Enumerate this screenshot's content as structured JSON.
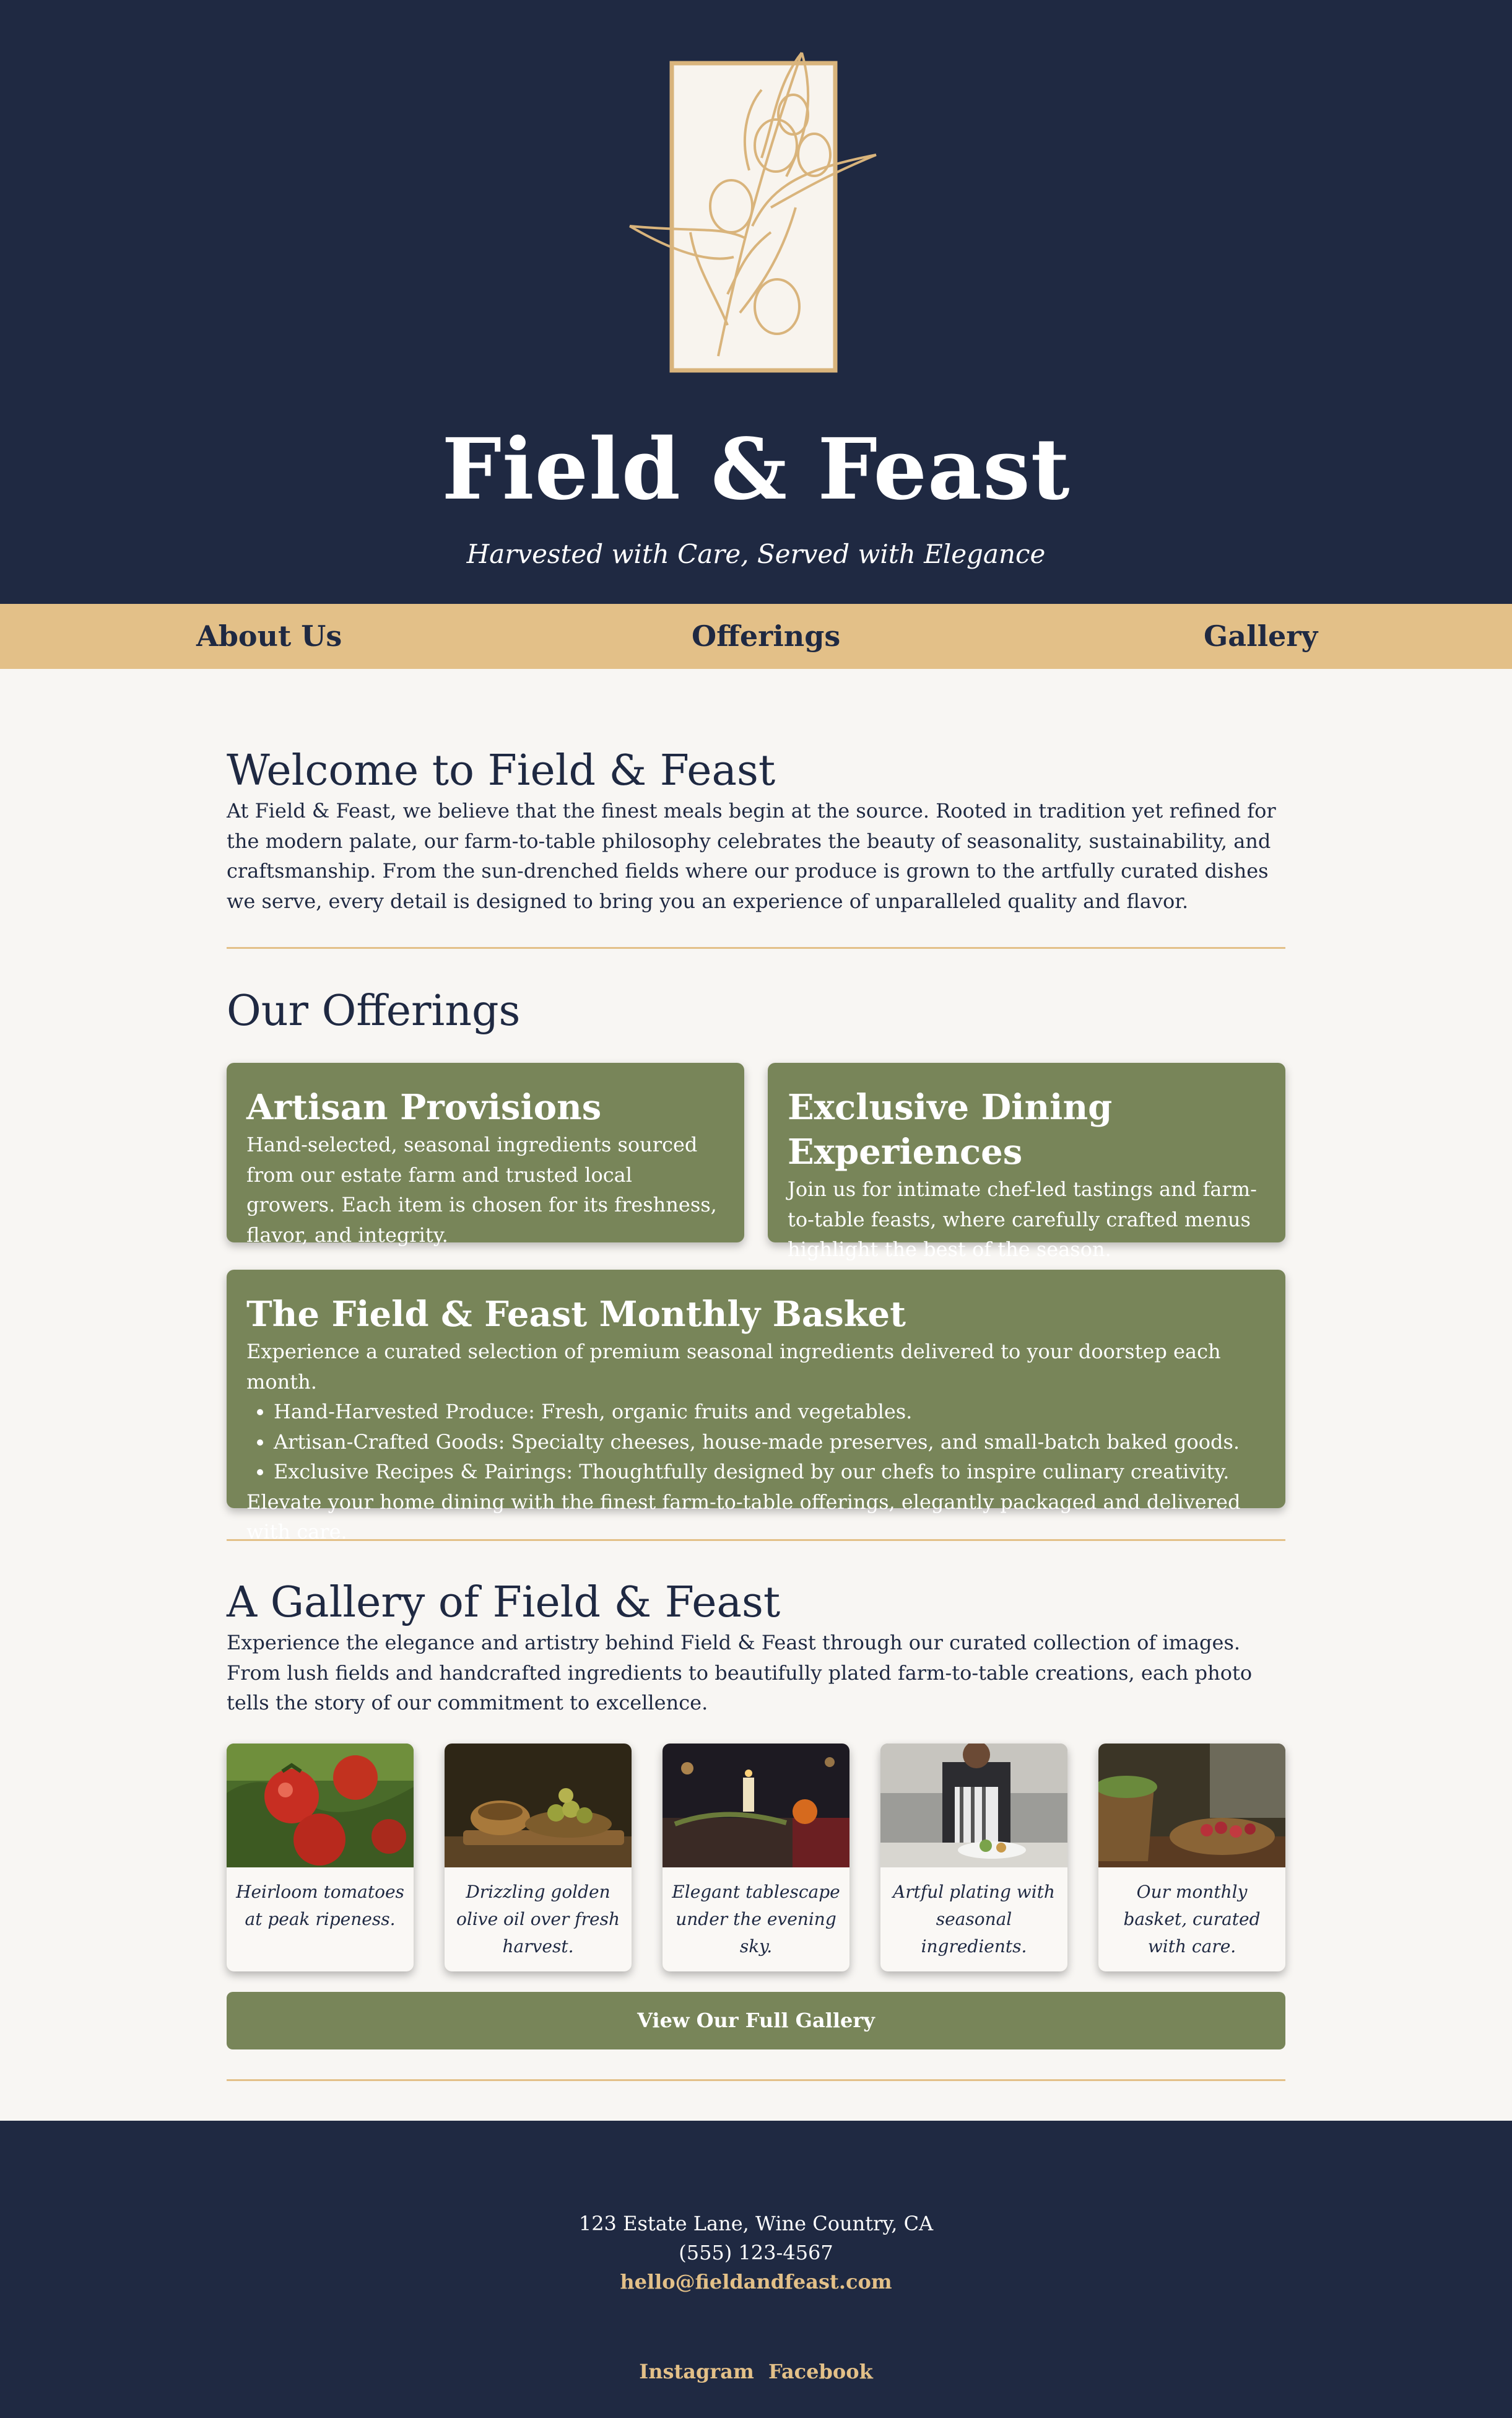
{
  "colors": {
    "navy": "#1f2942",
    "gold": "#e3c088",
    "olive": "#788559",
    "cream": "#f8f6f3"
  },
  "header": {
    "logo_icon": "olive-branch-icon",
    "title": "Field & Feast",
    "tagline": "Harvested with Care, Served with Elegance"
  },
  "nav": {
    "items": [
      "About Us",
      "Offerings",
      "Gallery"
    ]
  },
  "welcome": {
    "heading": "Welcome to Field & Feast",
    "text": "At Field & Feast, we believe that the finest meals begin at the source. Rooted in tradition yet refined for the modern palate, our farm-to-table philosophy celebrates the beauty of seasonality, sustainability, and craftsmanship. From the sun-drenched fields where our produce is grown to the artfully curated dishes we serve, every detail is designed to bring you an experience of unparalleled quality and flavor."
  },
  "offerings": {
    "heading": "Our Offerings",
    "cards": [
      {
        "title": "Artisan Provisions",
        "text": "Hand-selected, seasonal ingredients sourced from our estate farm and trusted local growers. Each item is chosen for its freshness, flavor, and integrity."
      },
      {
        "title": "Exclusive Dining Experiences",
        "text": "Join us for intimate chef-led tastings and farm-to-table feasts, where carefully crafted menus highlight the best of the season."
      }
    ],
    "basket": {
      "title": "The Field & Feast Monthly Basket",
      "intro": "Experience a curated selection of premium seasonal ingredients delivered to your doorstep each month.",
      "items": [
        "Hand-Harvested Produce: Fresh, organic fruits and vegetables.",
        "Artisan-Crafted Goods: Specialty cheeses, house-made preserves, and small-batch baked goods.",
        "Exclusive Recipes & Pairings: Thoughtfully designed by our chefs to inspire culinary creativity."
      ],
      "outro": "Elevate your home dining with the finest farm-to-table offerings, elegantly packaged and delivered with care."
    }
  },
  "gallery": {
    "heading": "A Gallery of Field & Feast",
    "text": "Experience the elegance and artistry behind Field & Feast through our curated collection of images. From lush fields and handcrafted ingredients to beautifully plated farm-to-table creations, each photo tells the story of our commitment to excellence.",
    "items": [
      {
        "caption": "Heirloom tomatoes at peak ripeness.",
        "image": "tomatoes-photo"
      },
      {
        "caption": "Drizzling golden olive oil over fresh harvest.",
        "image": "olive-oil-photo"
      },
      {
        "caption": "Elegant tablescape under the evening sky.",
        "image": "tablescape-photo"
      },
      {
        "caption": "Artful plating with seasonal ingredients.",
        "image": "chef-plating-photo"
      },
      {
        "caption": "Our monthly basket, curated with care.",
        "image": "basket-photo"
      }
    ],
    "button_label": "View Our Full Gallery"
  },
  "footer": {
    "address": "123 Estate Lane, Wine Country, CA",
    "phone": "(555) 123-4567",
    "email": "hello@fieldandfeast.com",
    "social": [
      "Instagram",
      "Facebook"
    ]
  }
}
